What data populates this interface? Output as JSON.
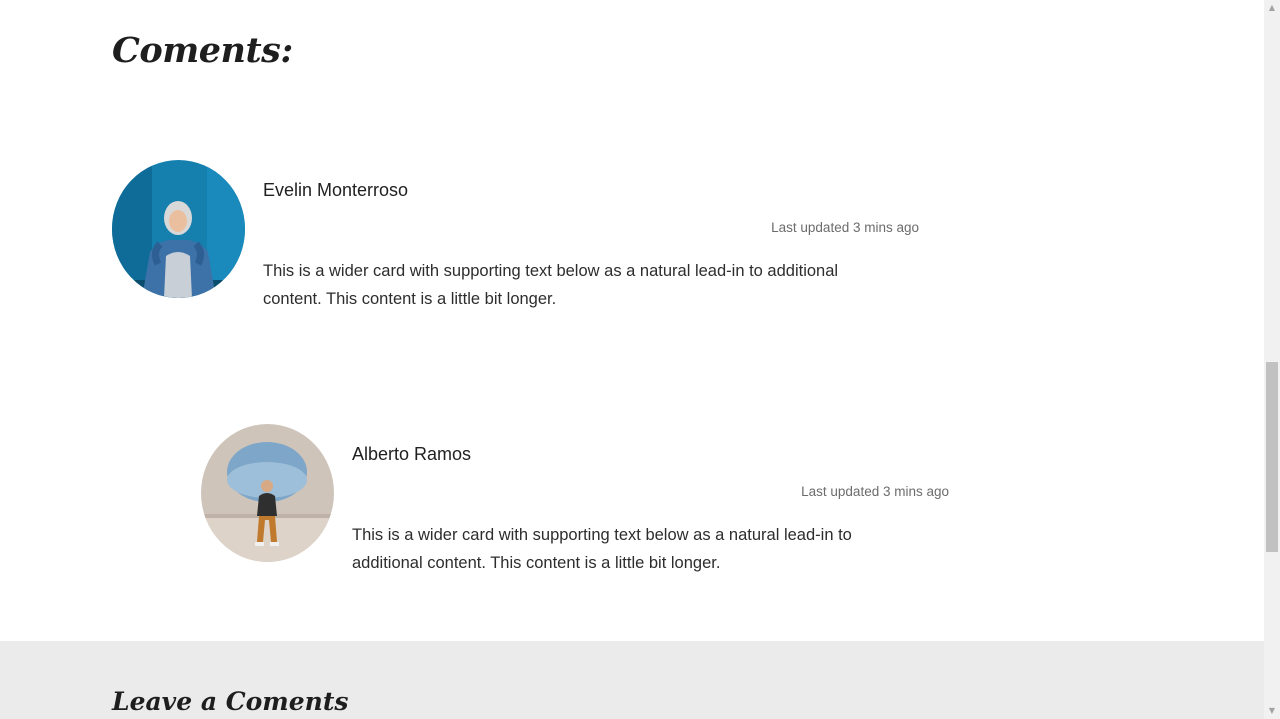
{
  "comments_section": {
    "title": "Coments:"
  },
  "comments": [
    {
      "author": "Evelin Monterroso",
      "timestamp": "Last updated 3 mins ago",
      "text": "This is a wider card with supporting text below as a natural lead-in to additional content. This content is a little bit longer."
    },
    {
      "author": "Alberto Ramos",
      "timestamp": "Last updated 3 mins ago",
      "text": "This is a wider card with supporting text below as a natural lead-in to additional content. This content is a little bit longer."
    }
  ],
  "leave_comment": {
    "title": "Leave a Coments"
  },
  "scrollbar": {
    "up_icon": "triangle-up",
    "down_icon": "triangle-down"
  }
}
